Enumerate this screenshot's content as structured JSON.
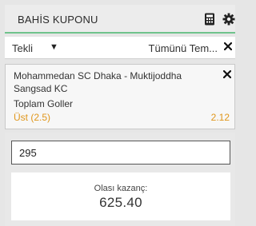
{
  "header": {
    "title": "BAHİS KUPONU",
    "icons": [
      "calculator-icon",
      "gear-icon"
    ]
  },
  "bet_type": {
    "selected": "Tekli",
    "remove_all_label": "Tümünü Tem..."
  },
  "selection": {
    "match": "Mohammedan SC Dhaka - Muktijoddha Sangsad KC",
    "market": "Toplam Goller",
    "pick": "Üst (2.5)",
    "odds": "2.12"
  },
  "stake": {
    "value": "295"
  },
  "potential_win": {
    "label": "Olası kazanç:",
    "value": "625.40"
  },
  "colors": {
    "accent": "#6fc38c",
    "odds": "#e0961b"
  }
}
